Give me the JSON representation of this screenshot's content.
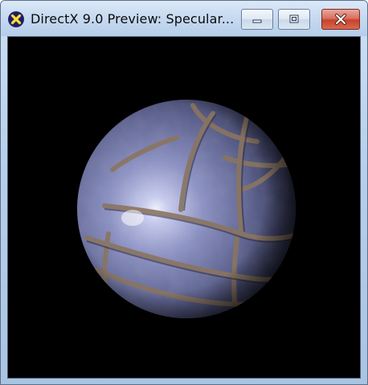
{
  "window": {
    "title": "DirectX 9.0 Preview: Specular...",
    "app_icon": "directx-x-icon"
  },
  "controls": {
    "minimize_icon": "minimize-icon",
    "maximize_icon": "maximize-icon",
    "close_icon": "close-icon"
  },
  "scene": {
    "object": "stone-textured-sphere",
    "background_color": "#000000",
    "material": "specular"
  },
  "colors": {
    "close_button": "#c7422c",
    "titlebar": "#c6d9f0",
    "stone": "#7f86b6",
    "mortar": "#8a7560"
  }
}
